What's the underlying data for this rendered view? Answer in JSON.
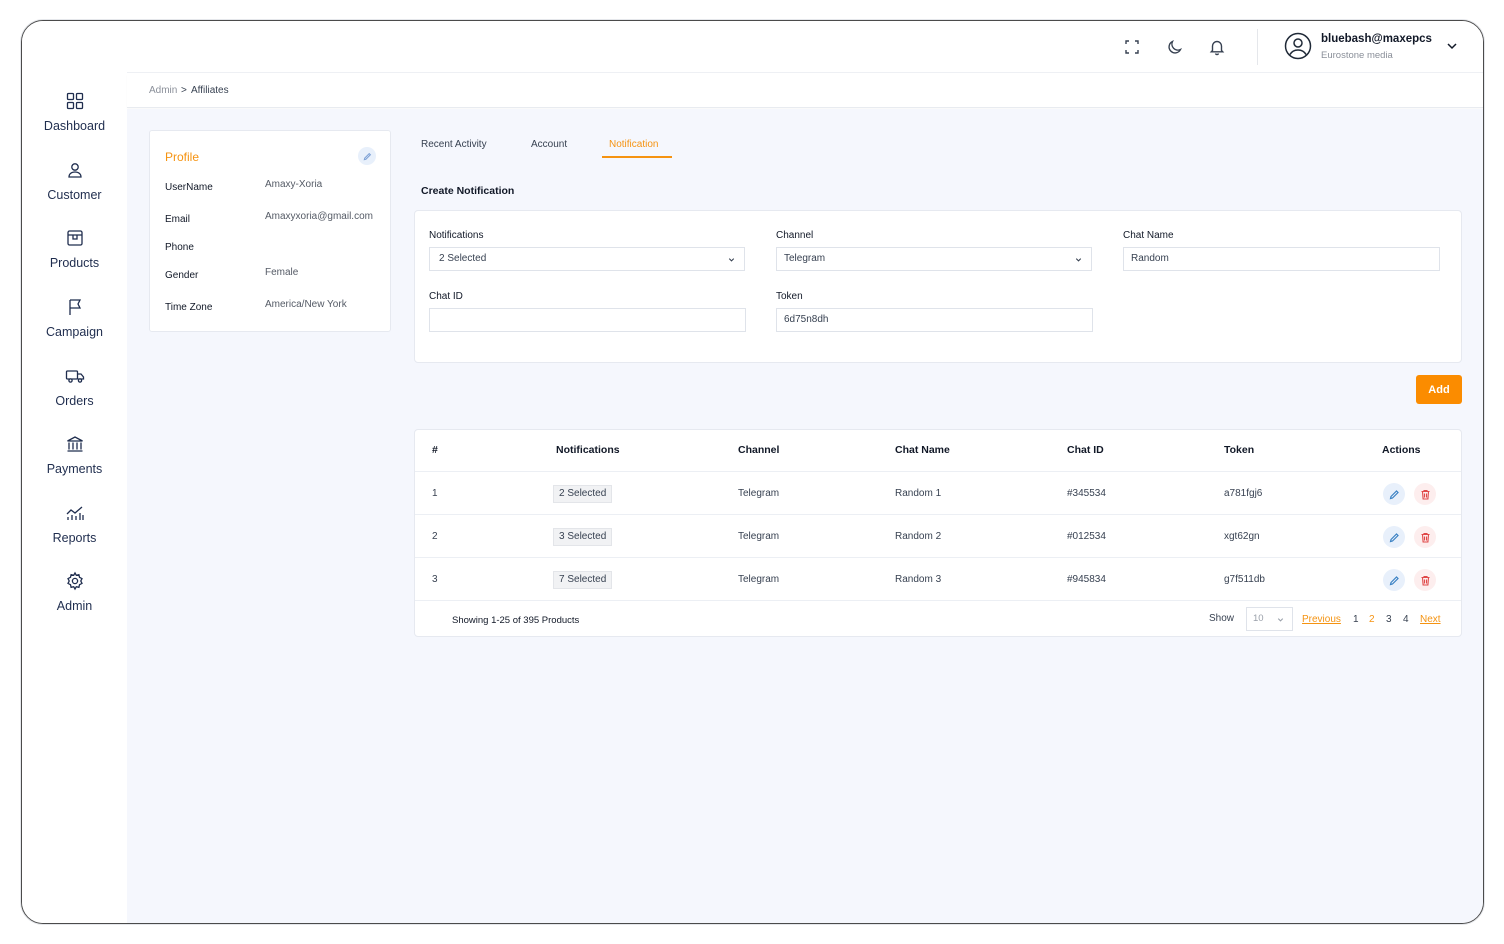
{
  "user": {
    "name": "bluebash@maxepcs",
    "org": "Eurostone media"
  },
  "breadcrumb": {
    "root": "Admin",
    "separator": ">",
    "current": "Affiliates"
  },
  "sidebar": {
    "items": [
      {
        "label": "Dashboard",
        "icon": "dashboard-icon"
      },
      {
        "label": "Customer",
        "icon": "user-icon"
      },
      {
        "label": "Products",
        "icon": "box-icon"
      },
      {
        "label": "Campaign",
        "icon": "flag-icon"
      },
      {
        "label": "Orders",
        "icon": "truck-icon"
      },
      {
        "label": "Payments",
        "icon": "bank-icon"
      },
      {
        "label": "Reports",
        "icon": "chart-icon"
      },
      {
        "label": "Admin",
        "icon": "gear-icon"
      }
    ]
  },
  "profile": {
    "title": "Profile",
    "fields": [
      {
        "label": "UserName",
        "value": "Amaxy-Xoria"
      },
      {
        "label": "Email",
        "value": "Amaxyxoria@gmail.com"
      },
      {
        "label": "Phone",
        "value": ""
      },
      {
        "label": "Gender",
        "value": "Female"
      },
      {
        "label": "Time Zone",
        "value": "America/New York"
      }
    ]
  },
  "tabs": [
    {
      "label": "Recent Activity",
      "active": false
    },
    {
      "label": "Account",
      "active": false
    },
    {
      "label": "Notification",
      "active": true
    }
  ],
  "form": {
    "title": "Create Notification",
    "notifications": {
      "label": "Notifications",
      "value": "2 Selected"
    },
    "channel": {
      "label": "Channel",
      "value": "Telegram"
    },
    "chat_name": {
      "label": "Chat Name",
      "value": "Random"
    },
    "chat_id": {
      "label": "Chat ID",
      "value": ""
    },
    "token": {
      "label": "Token",
      "value": "6d75n8dh"
    },
    "add_label": "Add"
  },
  "table": {
    "headers": [
      "#",
      "Notifications",
      "Channel",
      "Chat Name",
      "Chat ID",
      "Token",
      "Actions"
    ],
    "rows": [
      {
        "num": "1",
        "notifications": "2 Selected",
        "channel": "Telegram",
        "chat_name": "Random 1",
        "chat_id": "#345534",
        "token": "a781fgj6"
      },
      {
        "num": "2",
        "notifications": "3 Selected",
        "channel": "Telegram",
        "chat_name": "Random 2",
        "chat_id": "#012534",
        "token": "xgt62gn"
      },
      {
        "num": "3",
        "notifications": "7 Selected",
        "channel": "Telegram",
        "chat_name": "Random 3",
        "chat_id": "#945834",
        "token": "g7f511db"
      }
    ],
    "footer": {
      "showing": "Showing 1-25 of 395 Products",
      "show_label": "Show",
      "page_size": "10",
      "previous": "Previous",
      "pages": [
        "1",
        "2",
        "3",
        "4"
      ],
      "current_page": "2",
      "next": "Next"
    }
  },
  "colors": {
    "accent": "#f59311",
    "add_button": "#fb8c00",
    "edit_bg": "#e8f0fb",
    "delete_bg": "#fdeeee",
    "content_bg": "#f5f7fd"
  }
}
